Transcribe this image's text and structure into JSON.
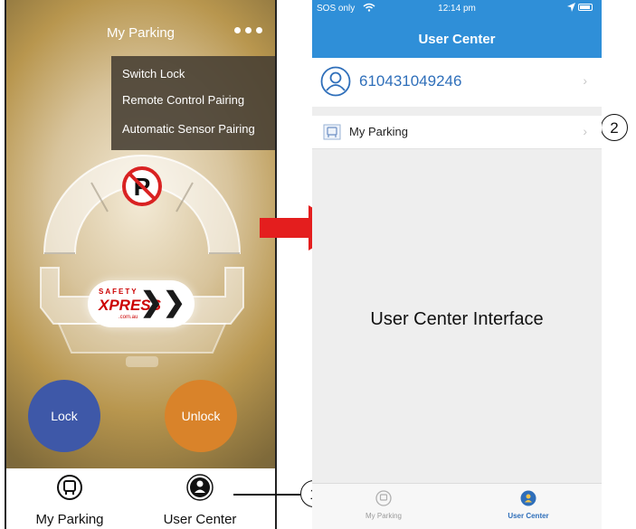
{
  "left_phone": {
    "title": "My Parking",
    "more_icon": "ellipsis-icon",
    "menu": [
      "Switch Lock",
      "Remote Control Pairing",
      "Automatic Sensor Pairing"
    ],
    "brand": {
      "top": "SAFETY",
      "main": "XPRESS",
      "sub": ".com.au",
      "chevrons": "❯❯"
    },
    "lock_label": "Lock",
    "unlock_label": "Unlock",
    "tabs": [
      {
        "label": "My Parking",
        "icon": "parking-icon"
      },
      {
        "label": "User Center",
        "icon": "user-icon"
      }
    ],
    "colors": {
      "lock": "#3e58a8",
      "unlock": "#d9832a"
    }
  },
  "callouts": [
    "1",
    "2"
  ],
  "right_phone": {
    "status": {
      "carrier": "SOS only",
      "time": "12:14 pm"
    },
    "title": "User Center",
    "user_id": "610431049246",
    "parking_label": "My Parking",
    "chevron": "›",
    "caption": "User Center Interface",
    "tabs": [
      {
        "label": "My Parking",
        "icon": "parking-icon",
        "active": false
      },
      {
        "label": "User Center",
        "icon": "user-icon",
        "active": true
      }
    ],
    "colors": {
      "header": "#2f8fd8",
      "active_tab": "#2f6fba"
    }
  }
}
